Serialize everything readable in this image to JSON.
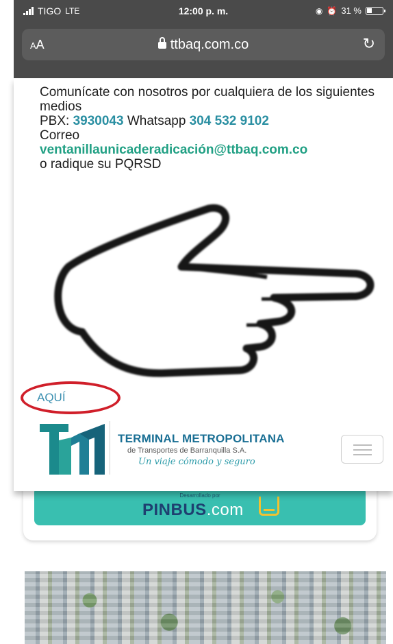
{
  "status_bar": {
    "carrier": "TIGO",
    "network": "LTE",
    "time": "12:00 p. m.",
    "battery": "31 %"
  },
  "browser": {
    "text_size": "AA",
    "domain": "ttbaq.com.co",
    "reload_glyph": "↻"
  },
  "popup": {
    "line1": "Comunícate con nosotros por cualquiera de los siguientes medios",
    "pbx_label": "PBX:",
    "pbx_number": "3930043",
    "whatsapp_label": "Whatsapp",
    "whatsapp_number": "304 532 9102",
    "correo_label": "Correo",
    "email": "ventanillaunicaderadicación@ttbaq.com.co",
    "radique": "o radique su PQRSD",
    "aqui": "AQUÍ",
    "annotation_color": "#d01f2a"
  },
  "header": {
    "brand_title": "TERMINAL METROPOLITANA",
    "brand_subtitle": "de Transportes de Barranquilla S.A.",
    "slogan": "Un viaje cómodo y seguro",
    "accent_teal": "#2a9aa8",
    "accent_dark": "#1a6f94"
  },
  "pinbus": {
    "developed_by": "Desarrollado por",
    "name": "PINBUS",
    "tld": ".com",
    "button_color": "#39bfb0"
  },
  "icons": [
    "signal-icon",
    "lock-icon",
    "reload-icon",
    "battery-icon",
    "alarm-icon",
    "hand-pointer-icon",
    "hamburger-menu-icon",
    "bus-icon"
  ]
}
